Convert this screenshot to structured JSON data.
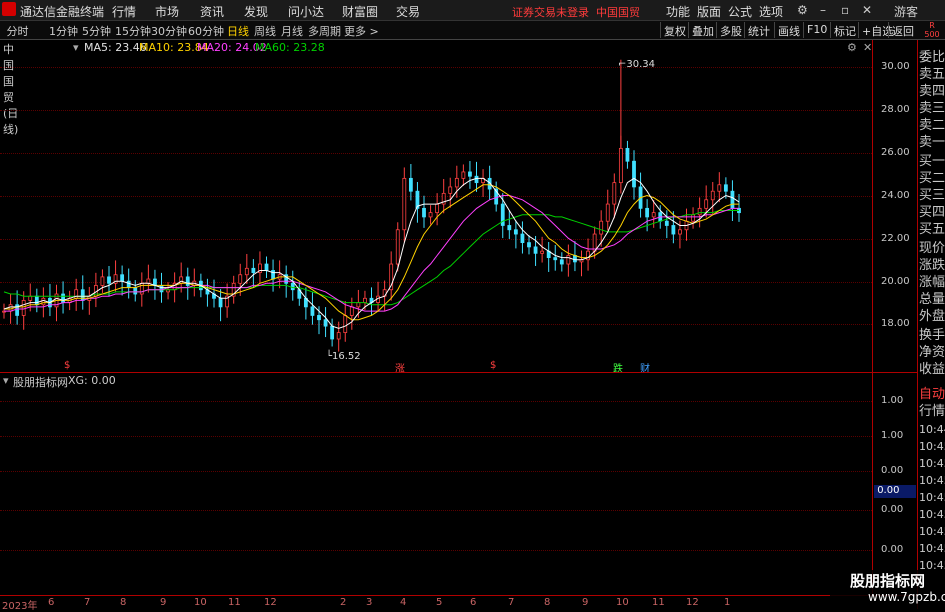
{
  "app": {
    "title": "通达信金融终端",
    "menu": [
      "行情",
      "市场",
      "资讯",
      "发现",
      "问小达",
      "财富圈",
      "交易"
    ],
    "warning": "证券交易未登录",
    "stock_name": "中国国贸",
    "right_menu": [
      "功能",
      "版面",
      "公式",
      "选项"
    ],
    "user": "游客"
  },
  "toolbar": {
    "periods": [
      "分时",
      "1分钟",
      "5分钟",
      "15分钟",
      "30分钟",
      "60分钟",
      "日线",
      "周线",
      "月线",
      "多周期",
      "更多 >"
    ],
    "active_period": "日线",
    "buttons": [
      "复权",
      "叠加",
      "多股",
      "统计",
      "画线",
      "F10",
      "标记",
      "+自选",
      "返回"
    ]
  },
  "chart_info": {
    "stock": "中国国贸(日线)",
    "ma5": "MA5: 23.46",
    "ma10": "MA10: 23.84",
    "ma20": "MA20: 24.02",
    "ma60": "MA60: 23.28"
  },
  "indicator": {
    "name": "股朋指标网",
    "value": "XG: 0.00"
  },
  "chart_data": {
    "type": "line",
    "y_ticks": [
      "30.00",
      "28.00",
      "26.00",
      "24.00",
      "22.00",
      "20.00",
      "18.00"
    ],
    "ylim": [
      16.0,
      30.6
    ],
    "high_label": "30.34",
    "low_label": "16.52",
    "indicator_ticks": [
      "1.00",
      "1.00",
      "0.00",
      "0.00",
      "0.00"
    ],
    "indicator_highlight": "0.00",
    "x_labels": [
      "2023年",
      "6",
      "7",
      "8",
      "9",
      "10",
      "11",
      "12",
      "2",
      "3",
      "4",
      "5",
      "6",
      "7",
      "8",
      "9",
      "10",
      "11",
      "12",
      "1"
    ],
    "events": [
      {
        "label": "$",
        "color": "#ff4040"
      },
      {
        "label": "涨",
        "color": "#ff4040"
      },
      {
        "label": "$",
        "color": "#ff4040"
      },
      {
        "label": "跌",
        "color": "#40ff40"
      },
      {
        "label": "财",
        "color": "#40a0ff"
      }
    ],
    "close": [
      18.6,
      18.9,
      18.4,
      19.1,
      19.3,
      18.9,
      19.2,
      18.8,
      19.4,
      19.0,
      19.2,
      19.6,
      19.1,
      19.3,
      19.8,
      20.2,
      19.9,
      20.3,
      20.0,
      19.7,
      19.4,
      19.9,
      20.1,
      19.8,
      19.5,
      19.6,
      19.9,
      20.2,
      19.8,
      20.0,
      19.6,
      19.4,
      19.2,
      18.8,
      19.3,
      19.9,
      20.3,
      20.6,
      20.4,
      20.8,
      20.5,
      20.1,
      20.3,
      19.9,
      19.6,
      19.2,
      18.8,
      18.4,
      18.2,
      17.9,
      17.3,
      17.6,
      18.4,
      18.8,
      19.0,
      19.2,
      19.0,
      19.3,
      19.6,
      20.8,
      22.4,
      24.8,
      24.2,
      23.4,
      23.0,
      23.2,
      23.6,
      24.1,
      24.4,
      24.8,
      25.1,
      24.9,
      24.6,
      24.8,
      24.3,
      23.6,
      22.6,
      22.4,
      22.2,
      21.8,
      21.6,
      21.3,
      21.4,
      21.1,
      21.0,
      20.8,
      21.2,
      20.9,
      21.0,
      21.4,
      22.2,
      22.8,
      23.6,
      24.6,
      26.2,
      25.6,
      24.4,
      23.4,
      23.0,
      23.2,
      22.8,
      22.6,
      22.2,
      22.4,
      22.8,
      23.1,
      23.4,
      23.8,
      24.2,
      24.5,
      24.2,
      23.4,
      23.2
    ],
    "ma5": [
      18.7,
      18.8,
      18.8,
      18.9,
      19.0,
      19.0,
      19.1,
      19.0,
      19.2,
      19.1,
      19.2,
      19.3,
      19.3,
      19.3,
      19.5,
      19.7,
      19.8,
      20.0,
      20.0,
      19.9,
      19.8,
      19.9,
      19.9,
      19.8,
      19.7,
      19.7,
      19.8,
      20.0,
      19.9,
      19.9,
      19.8,
      19.6,
      19.4,
      19.2,
      19.2,
      19.4,
      19.7,
      20.0,
      20.3,
      20.5,
      20.5,
      20.4,
      20.4,
      20.2,
      20.0,
      19.6,
      19.2,
      18.9,
      18.6,
      18.3,
      17.9,
      17.8,
      17.9,
      18.1,
      18.5,
      18.8,
      19.0,
      19.2,
      19.3,
      19.8,
      20.6,
      21.8,
      22.8,
      23.5,
      23.6,
      23.6,
      23.6,
      23.7,
      23.8,
      24.2,
      24.5,
      24.7,
      24.8,
      24.8,
      24.6,
      24.2,
      23.8,
      23.3,
      22.8,
      22.4,
      22.1,
      21.9,
      21.6,
      21.4,
      21.2,
      21.1,
      21.1,
      21.0,
      21.0,
      21.1,
      21.4,
      21.8,
      22.3,
      23.0,
      23.9,
      24.6,
      24.8,
      24.6,
      24.2,
      23.7,
      23.3,
      23.0,
      22.8,
      22.6,
      22.6,
      22.7,
      22.9,
      23.2,
      23.5,
      23.8,
      24.0,
      23.9,
      23.7
    ],
    "ma10": [
      18.7,
      18.7,
      18.8,
      18.8,
      18.9,
      18.9,
      19.0,
      19.0,
      19.1,
      19.1,
      19.1,
      19.2,
      19.2,
      19.2,
      19.3,
      19.4,
      19.5,
      19.6,
      19.7,
      19.7,
      19.7,
      19.8,
      19.8,
      19.8,
      19.8,
      19.8,
      19.8,
      19.9,
      19.9,
      19.8,
      19.8,
      19.7,
      19.6,
      19.5,
      19.4,
      19.4,
      19.5,
      19.6,
      19.7,
      19.9,
      20.0,
      20.1,
      20.2,
      20.2,
      20.2,
      20.0,
      19.8,
      19.6,
      19.4,
      19.2,
      18.9,
      18.6,
      18.4,
      18.2,
      18.2,
      18.3,
      18.4,
      18.6,
      18.9,
      19.2,
      19.6,
      20.2,
      20.9,
      21.6,
      22.2,
      22.6,
      23.0,
      23.3,
      23.5,
      23.7,
      23.9,
      24.1,
      24.3,
      24.5,
      24.5,
      24.4,
      24.2,
      24.0,
      23.7,
      23.4,
      23.1,
      22.8,
      22.4,
      22.0,
      21.8,
      21.5,
      21.3,
      21.2,
      21.1,
      21.1,
      21.2,
      21.4,
      21.7,
      22.1,
      22.6,
      23.2,
      23.6,
      23.9,
      24.0,
      23.9,
      23.7,
      23.4,
      23.1,
      22.9,
      22.8,
      22.7,
      22.8,
      22.9,
      23.1,
      23.3,
      23.5,
      23.6,
      23.6
    ],
    "ma20": [
      18.6,
      18.6,
      18.7,
      18.7,
      18.8,
      18.8,
      18.8,
      18.9,
      18.9,
      19.0,
      19.0,
      19.1,
      19.1,
      19.2,
      19.2,
      19.3,
      19.3,
      19.4,
      19.4,
      19.5,
      19.5,
      19.5,
      19.6,
      19.6,
      19.6,
      19.7,
      19.7,
      19.7,
      19.7,
      19.8,
      19.8,
      19.8,
      19.7,
      19.7,
      19.7,
      19.7,
      19.7,
      19.7,
      19.8,
      19.8,
      19.9,
      19.9,
      20.0,
      20.0,
      20.0,
      19.9,
      19.8,
      19.7,
      19.6,
      19.5,
      19.3,
      19.1,
      18.9,
      18.8,
      18.7,
      18.6,
      18.6,
      18.6,
      18.6,
      18.7,
      18.9,
      19.3,
      19.7,
      20.1,
      20.5,
      20.8,
      21.2,
      21.6,
      22.0,
      22.4,
      22.8,
      23.1,
      23.4,
      23.6,
      23.8,
      23.9,
      24.0,
      24.0,
      23.9,
      23.8,
      23.6,
      23.4,
      23.2,
      22.9,
      22.6,
      22.3,
      22.0,
      21.8,
      21.6,
      21.5,
      21.5,
      21.5,
      21.6,
      21.7,
      21.9,
      22.2,
      22.4,
      22.6,
      22.8,
      22.9,
      23.0,
      23.0,
      23.0,
      23.0,
      23.0,
      23.0,
      23.0,
      23.1,
      23.1,
      23.2,
      23.3,
      23.4,
      23.4
    ],
    "ma60": [
      19.5,
      19.4,
      19.4,
      19.3,
      19.3,
      19.3,
      19.3,
      19.3,
      19.3,
      19.3,
      19.3,
      19.3,
      19.3,
      19.3,
      19.4,
      19.4,
      19.4,
      19.5,
      19.5,
      19.5,
      19.5,
      19.5,
      19.6,
      19.6,
      19.6,
      19.6,
      19.6,
      19.7,
      19.7,
      19.7,
      19.7,
      19.7,
      19.7,
      19.7,
      19.7,
      19.7,
      19.7,
      19.7,
      19.7,
      19.8,
      19.8,
      19.8,
      19.8,
      19.8,
      19.7,
      19.7,
      19.6,
      19.5,
      19.4,
      19.3,
      19.2,
      19.1,
      19.0,
      19.0,
      19.0,
      19.0,
      18.9,
      18.9,
      18.9,
      18.9,
      19.0,
      19.2,
      19.4,
      19.6,
      19.8,
      20.0,
      20.2,
      20.5,
      20.7,
      21.0,
      21.3,
      21.6,
      21.9,
      22.2,
      22.4,
      22.6,
      22.8,
      22.9,
      23.0,
      23.1,
      23.1,
      23.1,
      23.1,
      23.1,
      23.0,
      23.0,
      22.9,
      22.8,
      22.7,
      22.6,
      22.5,
      22.4,
      22.3,
      22.3,
      22.3,
      22.3,
      22.4,
      22.5,
      22.6,
      22.7,
      22.8,
      22.9,
      23.0,
      23.0,
      23.1,
      23.1,
      23.2,
      23.2,
      23.2,
      23.3,
      23.3,
      23.3,
      23.3
    ],
    "colors": {
      "price": "#e0e0e0",
      "ma5": "#ffffff",
      "ma10": "#ffd200",
      "ma20": "#ff40ff",
      "ma60": "#00d000"
    }
  }
}
